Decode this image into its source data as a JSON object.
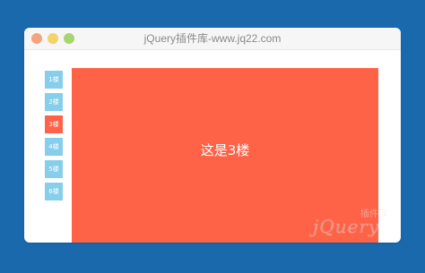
{
  "window": {
    "title": "jQuery插件库-www.jq22.com"
  },
  "floors": [
    {
      "label": "1楼",
      "active": false
    },
    {
      "label": "2楼",
      "active": false
    },
    {
      "label": "3楼",
      "active": true
    },
    {
      "label": "4楼",
      "active": false
    },
    {
      "label": "5楼",
      "active": false
    },
    {
      "label": "6楼",
      "active": false
    }
  ],
  "content": {
    "label": "这是3楼",
    "background": "#ff6347"
  },
  "colors": {
    "page_background": "#1a69ad",
    "nav_inactive": "#87ceeb",
    "nav_active": "#ff6347"
  },
  "watermark": {
    "main": "jQuery",
    "cn": "插件库"
  }
}
